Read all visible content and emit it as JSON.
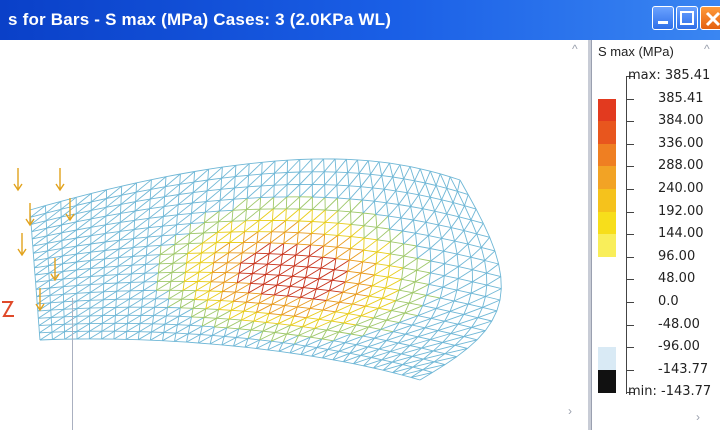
{
  "window": {
    "title": "s for Bars - S max (MPa) Cases: 3 (2.0KPa WL)"
  },
  "legend": {
    "title": "S max (MPa)",
    "max_prefix": "max:",
    "min_prefix": "min:",
    "labels": [
      "385.41",
      "385.41",
      "384.00",
      "336.00",
      "288.00",
      "240.00",
      "192.00",
      "144.00",
      "96.00",
      "48.00",
      "0.0",
      "-48.00",
      "-96.00",
      "-143.77",
      "-143.77"
    ],
    "colors": [
      "#ffffff",
      "#e23a1f",
      "#e8561e",
      "#ef7f22",
      "#f2a325",
      "#f5c21c",
      "#f7de1b",
      "#f9ee5a",
      "#ffffff",
      "#ffffff",
      "#ffffff",
      "#ffffff",
      "#d9eaf5",
      "#111111"
    ]
  },
  "icons": [
    "minimize-icon",
    "maximize-icon",
    "close-icon",
    "scroll-up-icon",
    "scroll-down-icon"
  ]
}
